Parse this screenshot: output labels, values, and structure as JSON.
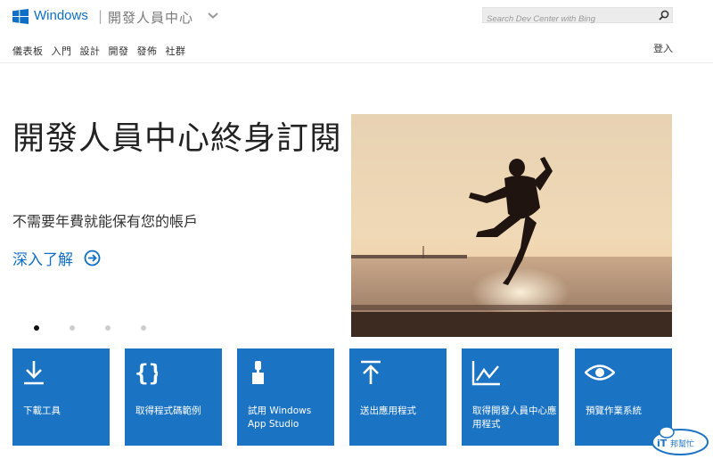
{
  "header": {
    "brand": "Windows",
    "separator": "|",
    "subtitle": "開發人員中心",
    "search_placeholder": "Search Dev Center with Bing",
    "signin": "登入"
  },
  "nav": [
    "儀表板",
    "入門",
    "設計",
    "開發",
    "發佈",
    "社群"
  ],
  "hero": {
    "title": "開發人員中心終身訂閱",
    "subtitle": "不需要年費就能保有您的帳戶",
    "learn_more": "深入了解",
    "carousel": {
      "count": 4,
      "active": 1
    }
  },
  "tiles": [
    {
      "label": "下載工具",
      "icon": "download-icon"
    },
    {
      "label": "取得程式碼範例",
      "icon": "braces-icon"
    },
    {
      "label": "試用 Windows App Studio",
      "icon": "brush-icon"
    },
    {
      "label": "送出應用程式",
      "icon": "upload-icon"
    },
    {
      "label": "取得開發人員中心應用程式",
      "icon": "chart-icon"
    },
    {
      "label": "預覽作業系統",
      "icon": "eye-icon"
    }
  ],
  "colors": {
    "accent": "#0f6fc6",
    "tile": "#1b73c4"
  },
  "watermark": {
    "text": "iT邦幫忙"
  }
}
